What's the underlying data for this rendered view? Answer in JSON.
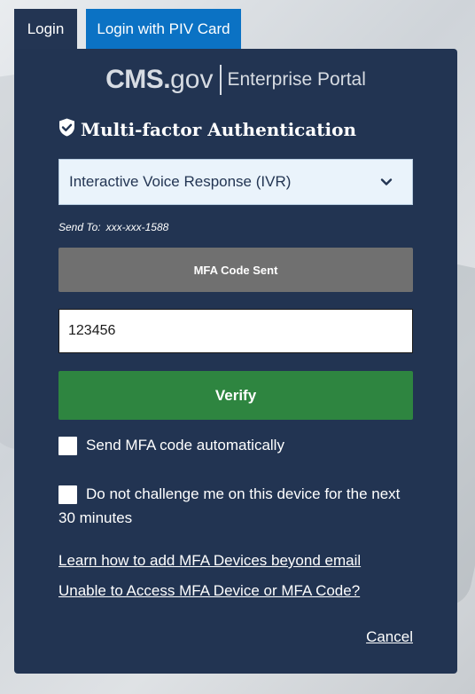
{
  "tabs": {
    "login": "Login",
    "piv": "Login with PIV Card"
  },
  "brand": {
    "cms": "CMS.",
    "gov": "gov",
    "portal": "Enterprise Portal"
  },
  "mfa": {
    "title": "Multi-factor Authentication",
    "title_icon": "shield-check-icon",
    "method_selected": "Interactive Voice Response (IVR)",
    "send_to_label": "Send To:",
    "send_to_value": "xxx-xxx-1588",
    "code_sent_label": "MFA Code Sent",
    "code_value": "123456",
    "verify_label": "Verify",
    "send_auto_label": "Send MFA code automatically",
    "dont_challenge_label": "Do not challenge me on this device for the next 30 minutes",
    "learn_link": "Learn how to add MFA Devices beyond email",
    "unable_link": "Unable to Access MFA Device or MFA Code?",
    "cancel_link": "Cancel"
  },
  "colors": {
    "panel": "#223452",
    "piv_tab": "#0b72c4",
    "verify": "#2e8540",
    "code_sent": "#707070"
  }
}
